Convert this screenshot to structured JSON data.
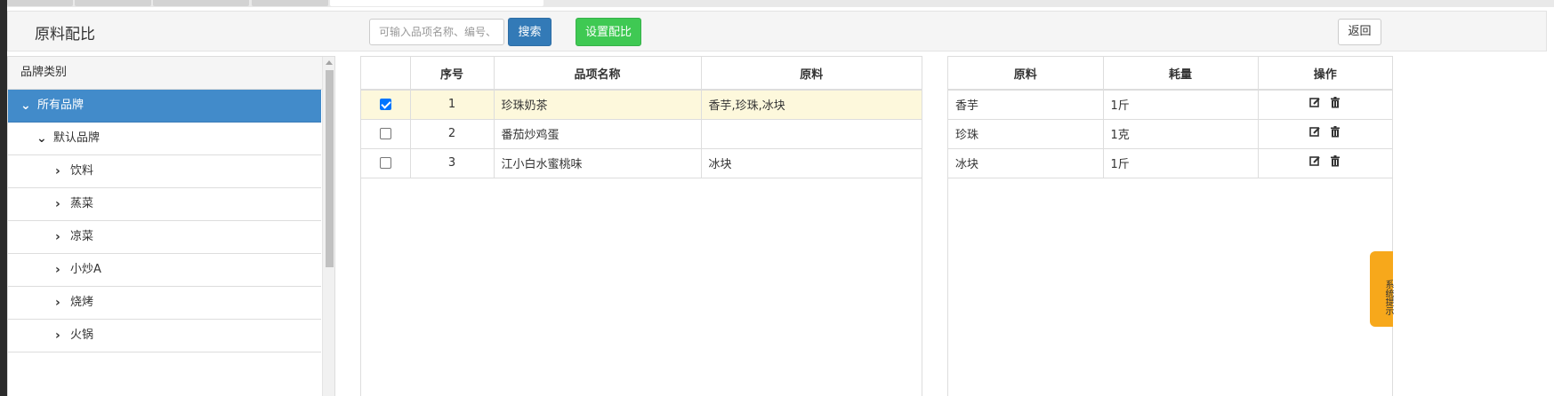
{
  "header": {
    "title": "原料配比",
    "search_placeholder": "可输入品项名称、编号、",
    "search_label": "搜索",
    "set_ratio_label": "设置配比",
    "back_label": "返回"
  },
  "tree": {
    "header": "品牌类别",
    "nodes": [
      {
        "label": "所有品牌"
      },
      {
        "label": "默认品牌"
      },
      {
        "label": "饮料"
      },
      {
        "label": "蒸菜"
      },
      {
        "label": "凉菜"
      },
      {
        "label": "小炒A"
      },
      {
        "label": "烧烤"
      },
      {
        "label": "火锅"
      }
    ]
  },
  "items_table": {
    "columns": [
      "序号",
      "品项名称",
      "原料"
    ],
    "rows": [
      {
        "checked": true,
        "no": "1",
        "name": "珍珠奶茶",
        "materials": "香芋,珍珠,冰块"
      },
      {
        "checked": false,
        "no": "2",
        "name": "番茄炒鸡蛋",
        "materials": ""
      },
      {
        "checked": false,
        "no": "3",
        "name": "江小白水蜜桃味",
        "materials": "冰块"
      }
    ]
  },
  "materials_table": {
    "columns": [
      "原料",
      "耗量",
      "操作"
    ],
    "rows": [
      {
        "material": "香芋",
        "amount": "1斤"
      },
      {
        "material": "珍珠",
        "amount": "1克"
      },
      {
        "material": "冰块",
        "amount": "1斤"
      }
    ]
  },
  "system_tip": "系统提示",
  "colors": {
    "primary": "#337ab7",
    "success": "#3fc953",
    "selected_node": "#428bca",
    "row_highlight": "#fdf8dc",
    "tip": "#f7a81b"
  }
}
